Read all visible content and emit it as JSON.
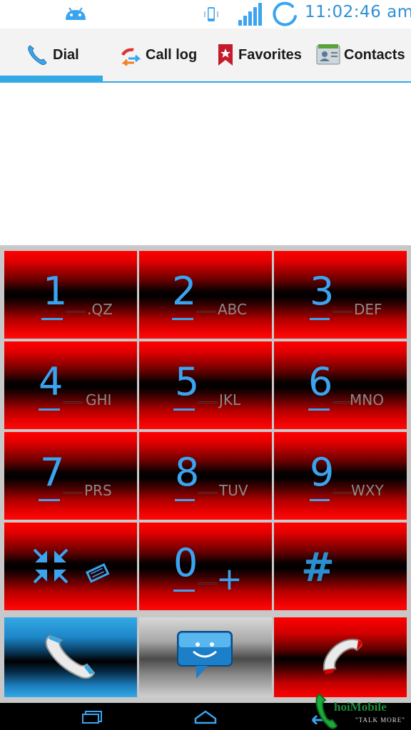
{
  "status_bar": {
    "time": "11:02:46 am",
    "icons": [
      "android-icon",
      "phone-vibrate-icon",
      "signal-icon",
      "sync-icon"
    ]
  },
  "tabs": [
    {
      "label": "Dial",
      "icon": "phone-icon",
      "selected": true
    },
    {
      "label": "Call log",
      "icon": "call-log-icon",
      "selected": false
    },
    {
      "label": "Favorites",
      "icon": "bookmark-star-icon",
      "selected": false
    },
    {
      "label": "Contacts",
      "icon": "contact-card-icon",
      "selected": false
    }
  ],
  "dial_number": "",
  "keys": [
    {
      "digit": "1",
      "letters": ".QZ"
    },
    {
      "digit": "2",
      "letters": "ABC"
    },
    {
      "digit": "3",
      "letters": "DEF"
    },
    {
      "digit": "4",
      "letters": "GHI"
    },
    {
      "digit": "5",
      "letters": "JKL"
    },
    {
      "digit": "6",
      "letters": "MNO"
    },
    {
      "digit": "7",
      "letters": "PRS"
    },
    {
      "digit": "8",
      "letters": "TUV"
    },
    {
      "digit": "9",
      "letters": "WXY"
    },
    {
      "digit": "*",
      "letters": "",
      "icon": "star-collapse-icon"
    },
    {
      "digit": "0",
      "letters": "+"
    },
    {
      "digit": "#",
      "letters": ""
    }
  ],
  "actions": [
    {
      "name": "call",
      "icon": "phone-handset-icon"
    },
    {
      "name": "message",
      "icon": "sms-smiley-icon"
    },
    {
      "name": "hangup",
      "icon": "end-call-icon"
    }
  ],
  "nav": [
    "recent-apps-icon",
    "home-icon",
    "back-icon"
  ],
  "watermark": {
    "name": "hoiMobile",
    "tagline": "\"TALK MORE\""
  },
  "colors": {
    "accent": "#33a9e5",
    "key_red": "#ff0000",
    "digit_blue": "#3aa4f0"
  }
}
